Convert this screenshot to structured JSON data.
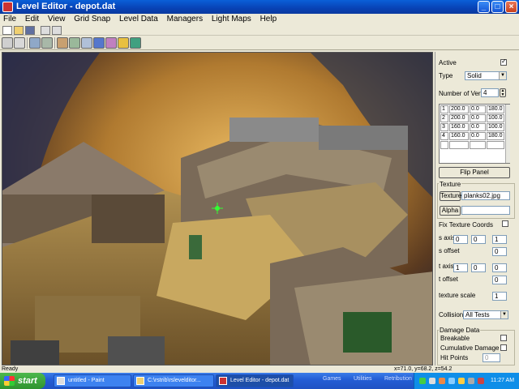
{
  "window": {
    "title": "Level Editor - depot.dat"
  },
  "menu": [
    "File",
    "Edit",
    "View",
    "Grid Snap",
    "Level Data",
    "Managers",
    "Light Maps",
    "Help"
  ],
  "panel": {
    "active_label": "Active",
    "type_label": "Type",
    "type_value": "Solid",
    "num_verts_label": "Number of Verts",
    "num_verts_value": "4",
    "verts": [
      [
        "1",
        "200.0",
        "0.0",
        "180.0"
      ],
      [
        "2",
        "200.0",
        "0.0",
        "100.0"
      ],
      [
        "3",
        "160.0",
        "0.0",
        "100.0"
      ],
      [
        "4",
        "160.0",
        "0.0",
        "180.0"
      ]
    ],
    "flip_panel": "Flip Panel",
    "texture_group": "Texture",
    "texture_button": "Texture",
    "texture_value": "planks02.jpg",
    "alpha_button": "Alpha",
    "fix_coords": "Fix Texture Coords",
    "s_axis": "s axis",
    "s_axis_vals": [
      "0",
      "0",
      "1"
    ],
    "s_offset": "s offset",
    "s_offset_val": "0",
    "t_axis": "t axis",
    "t_axis_vals": [
      "1",
      "0",
      "0"
    ],
    "t_offset": "t offset",
    "t_offset_val": "0",
    "texture_scale": "texture scale",
    "texture_scale_val": "1",
    "collisions_label": "Collisions",
    "collisions_value": "All Tests",
    "damage_group": "Damage Data",
    "breakable": "Breakable",
    "cumulative": "Cumulative Damage",
    "hit_points": "Hit Points",
    "hit_points_val": "0"
  },
  "status": {
    "left": "Ready",
    "coords": "x=71.0, y=68.2, z=54.2"
  },
  "taskbar": {
    "start": "start",
    "tasks": [
      "untitled - Paint",
      "C:\\rstrib\\rslevelditor...",
      "Level Editor - depot.dat"
    ],
    "quick": [
      "Games",
      "Utilities",
      "Retribution"
    ],
    "clock": "11:27 AM"
  }
}
